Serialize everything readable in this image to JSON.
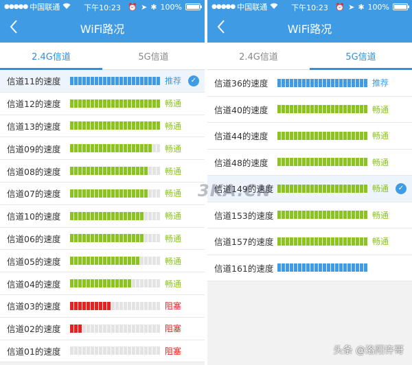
{
  "colors": {
    "accent": "#3f9be3",
    "good": "#8cc31f",
    "bad": "#e52222",
    "recommend": "#3f9be3",
    "empty": "#e3e3e3"
  },
  "status_bar": {
    "carrier": "中国联通",
    "time": "下午10:23",
    "battery": "100%"
  },
  "nav": {
    "title": "WiFi路况",
    "back_icon": "chevron-left-icon"
  },
  "tabs": [
    "2.4G信道",
    "5G信道"
  ],
  "left_panel": {
    "active_tab": 0,
    "segments_total": 22,
    "rows": [
      {
        "label": "信道11的速度",
        "filled": 22,
        "color": "blue",
        "status": "推荐",
        "selected": true
      },
      {
        "label": "信道12的速度",
        "filled": 22,
        "color": "green",
        "status": "畅通",
        "selected": false
      },
      {
        "label": "信道13的速度",
        "filled": 22,
        "color": "green",
        "status": "畅通",
        "selected": false
      },
      {
        "label": "信道09的速度",
        "filled": 20,
        "color": "green",
        "status": "畅通",
        "selected": false
      },
      {
        "label": "信道08的速度",
        "filled": 19,
        "color": "green",
        "status": "畅通",
        "selected": false
      },
      {
        "label": "信道07的速度",
        "filled": 19,
        "color": "green",
        "status": "畅通",
        "selected": false
      },
      {
        "label": "信道10的速度",
        "filled": 18,
        "color": "green",
        "status": "畅通",
        "selected": false
      },
      {
        "label": "信道06的速度",
        "filled": 18,
        "color": "green",
        "status": "畅通",
        "selected": false
      },
      {
        "label": "信道05的速度",
        "filled": 17,
        "color": "green",
        "status": "畅通",
        "selected": false
      },
      {
        "label": "信道04的速度",
        "filled": 15,
        "color": "green",
        "status": "畅通",
        "selected": false
      },
      {
        "label": "信道03的速度",
        "filled": 10,
        "color": "red",
        "status": "阻塞",
        "selected": false
      },
      {
        "label": "信道02的速度",
        "filled": 3,
        "color": "red",
        "status": "阻塞",
        "selected": false
      },
      {
        "label": "信道01的速度",
        "filled": 0,
        "color": "red",
        "status": "阻塞",
        "selected": false
      }
    ]
  },
  "right_panel": {
    "active_tab": 1,
    "segments_total": 22,
    "rows": [
      {
        "label": "信道36的速度",
        "filled": 22,
        "color": "blue",
        "status": "推荐",
        "selected": false
      },
      {
        "label": "信道40的速度",
        "filled": 22,
        "color": "green",
        "status": "畅通",
        "selected": false
      },
      {
        "label": "信道44的速度",
        "filled": 22,
        "color": "green",
        "status": "畅通",
        "selected": false
      },
      {
        "label": "信道48的速度",
        "filled": 22,
        "color": "green",
        "status": "畅通",
        "selected": false
      },
      {
        "label": "信道149的速度",
        "filled": 22,
        "color": "green",
        "status": "畅通",
        "selected": true
      },
      {
        "label": "信道153的速度",
        "filled": 22,
        "color": "green",
        "status": "畅通",
        "selected": false
      },
      {
        "label": "信道157的速度",
        "filled": 22,
        "color": "green",
        "status": "畅通",
        "selected": false
      },
      {
        "label": "信道161的速度",
        "filled": 22,
        "color": "blue",
        "status": "",
        "selected": false
      }
    ]
  },
  "watermark": "3KA.CN",
  "credit": "头条 @洛阳许哥"
}
